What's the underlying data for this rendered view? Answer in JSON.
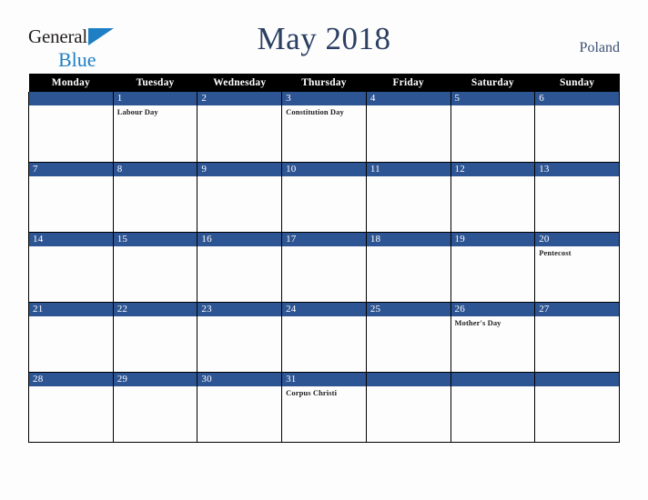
{
  "brand": {
    "name_part1": "General",
    "name_part2": "Blue",
    "triangle_color": "#1f7fc4"
  },
  "header": {
    "title": "May 2018",
    "country": "Poland",
    "title_color": "#2b3f63",
    "country_color": "#3b4f73"
  },
  "calendar": {
    "accent_color": "#2e5593",
    "header_bg": "#000000",
    "weekday_headers": [
      "Monday",
      "Tuesday",
      "Wednesday",
      "Thursday",
      "Friday",
      "Saturday",
      "Sunday"
    ],
    "weeks": [
      [
        {
          "day": "",
          "event": "",
          "blank": true
        },
        {
          "day": "1",
          "event": "Labour Day"
        },
        {
          "day": "2",
          "event": ""
        },
        {
          "day": "3",
          "event": "Constitution Day"
        },
        {
          "day": "4",
          "event": ""
        },
        {
          "day": "5",
          "event": ""
        },
        {
          "day": "6",
          "event": ""
        }
      ],
      [
        {
          "day": "7",
          "event": ""
        },
        {
          "day": "8",
          "event": ""
        },
        {
          "day": "9",
          "event": ""
        },
        {
          "day": "10",
          "event": ""
        },
        {
          "day": "11",
          "event": ""
        },
        {
          "day": "12",
          "event": ""
        },
        {
          "day": "13",
          "event": ""
        }
      ],
      [
        {
          "day": "14",
          "event": ""
        },
        {
          "day": "15",
          "event": ""
        },
        {
          "day": "16",
          "event": ""
        },
        {
          "day": "17",
          "event": ""
        },
        {
          "day": "18",
          "event": ""
        },
        {
          "day": "19",
          "event": ""
        },
        {
          "day": "20",
          "event": "Pentecost"
        }
      ],
      [
        {
          "day": "21",
          "event": ""
        },
        {
          "day": "22",
          "event": ""
        },
        {
          "day": "23",
          "event": ""
        },
        {
          "day": "24",
          "event": ""
        },
        {
          "day": "25",
          "event": ""
        },
        {
          "day": "26",
          "event": "Mother's Day"
        },
        {
          "day": "27",
          "event": ""
        }
      ],
      [
        {
          "day": "28",
          "event": ""
        },
        {
          "day": "29",
          "event": ""
        },
        {
          "day": "30",
          "event": ""
        },
        {
          "day": "31",
          "event": "Corpus Christi"
        },
        {
          "day": "",
          "event": "",
          "blank": true
        },
        {
          "day": "",
          "event": "",
          "blank": true
        },
        {
          "day": "",
          "event": "",
          "blank": true
        }
      ]
    ]
  }
}
